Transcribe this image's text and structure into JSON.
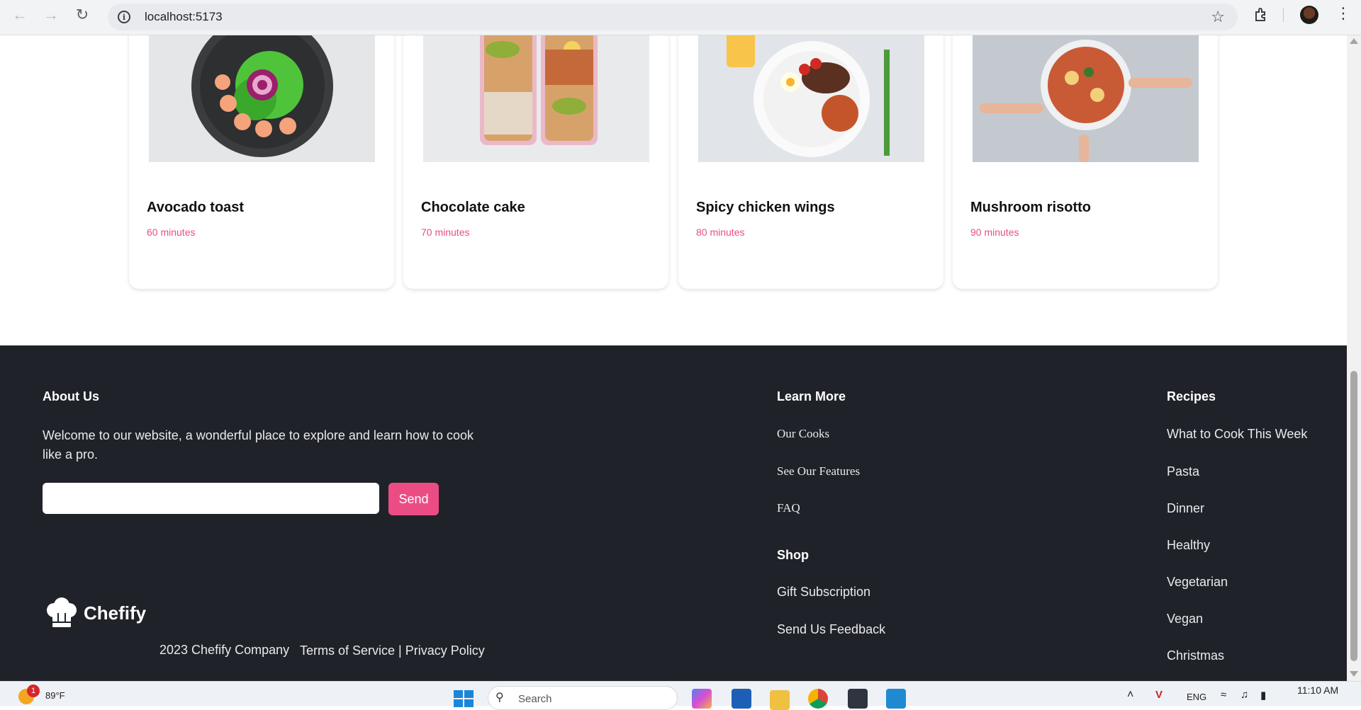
{
  "browser": {
    "url": "localhost:5173"
  },
  "cards": [
    {
      "title": "Avocado toast",
      "time": "60 minutes"
    },
    {
      "title": "Chocolate cake",
      "time": "70 minutes"
    },
    {
      "title": "Spicy chicken wings",
      "time": "80 minutes"
    },
    {
      "title": "Mushroom risotto",
      "time": "90 minutes"
    }
  ],
  "footer": {
    "about": {
      "heading": "About Us",
      "text": "Welcome to our website, a wonderful place to explore and learn how to cook like a pro.",
      "email_value": "",
      "send_label": "Send"
    },
    "learn_more": {
      "heading": "Learn More",
      "links": [
        "Our Cooks",
        "See Our Features",
        "FAQ"
      ]
    },
    "shop": {
      "heading": "Shop",
      "links": [
        "Gift Subscription",
        "Send Us Feedback"
      ]
    },
    "recipes": {
      "heading": "Recipes",
      "links": [
        "What to Cook This Week",
        "Pasta",
        "Dinner",
        "Healthy",
        "Vegetarian",
        "Vegan",
        "Christmas"
      ]
    },
    "brand": "Chefify",
    "copyright": "2023 Chefify Company",
    "legal": "Terms of Service | Privacy Policy"
  },
  "taskbar": {
    "weather_badge": "1",
    "temperature": "89°F",
    "search_placeholder": "Search",
    "language": "ENG",
    "time": "11:10 AM"
  },
  "colors": {
    "accent": "#ec4c84",
    "time_text": "#e84c88",
    "footer_bg": "#1f2229"
  }
}
